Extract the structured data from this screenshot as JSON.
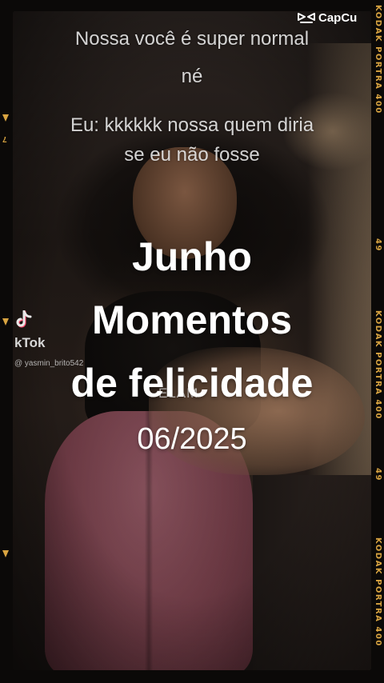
{
  "film": {
    "rebate_labels": [
      "KODAK PORTRA 400",
      "49",
      "KODAK PORTRA 400",
      "49",
      "KODAK PORTRA 400"
    ],
    "left_marker": "7",
    "rebate_color": "#d9a441"
  },
  "capcut": {
    "label": "CapCu",
    "icon": "capcut-logo-icon"
  },
  "captions": {
    "line1": "Nossa você é super normal",
    "line2": "né",
    "line3": "Eu: kkkkkk nossa quem diria",
    "line4": "se eu não fosse"
  },
  "tiktok": {
    "name": "kTok",
    "handle": "@ yasmin_brito542",
    "icon": "tiktok-note-icon"
  },
  "overlay": {
    "title1": "Junho",
    "title2": "Momentos",
    "title3": "de felicidade",
    "date": "06/2025"
  },
  "stray_text": "ELAM"
}
